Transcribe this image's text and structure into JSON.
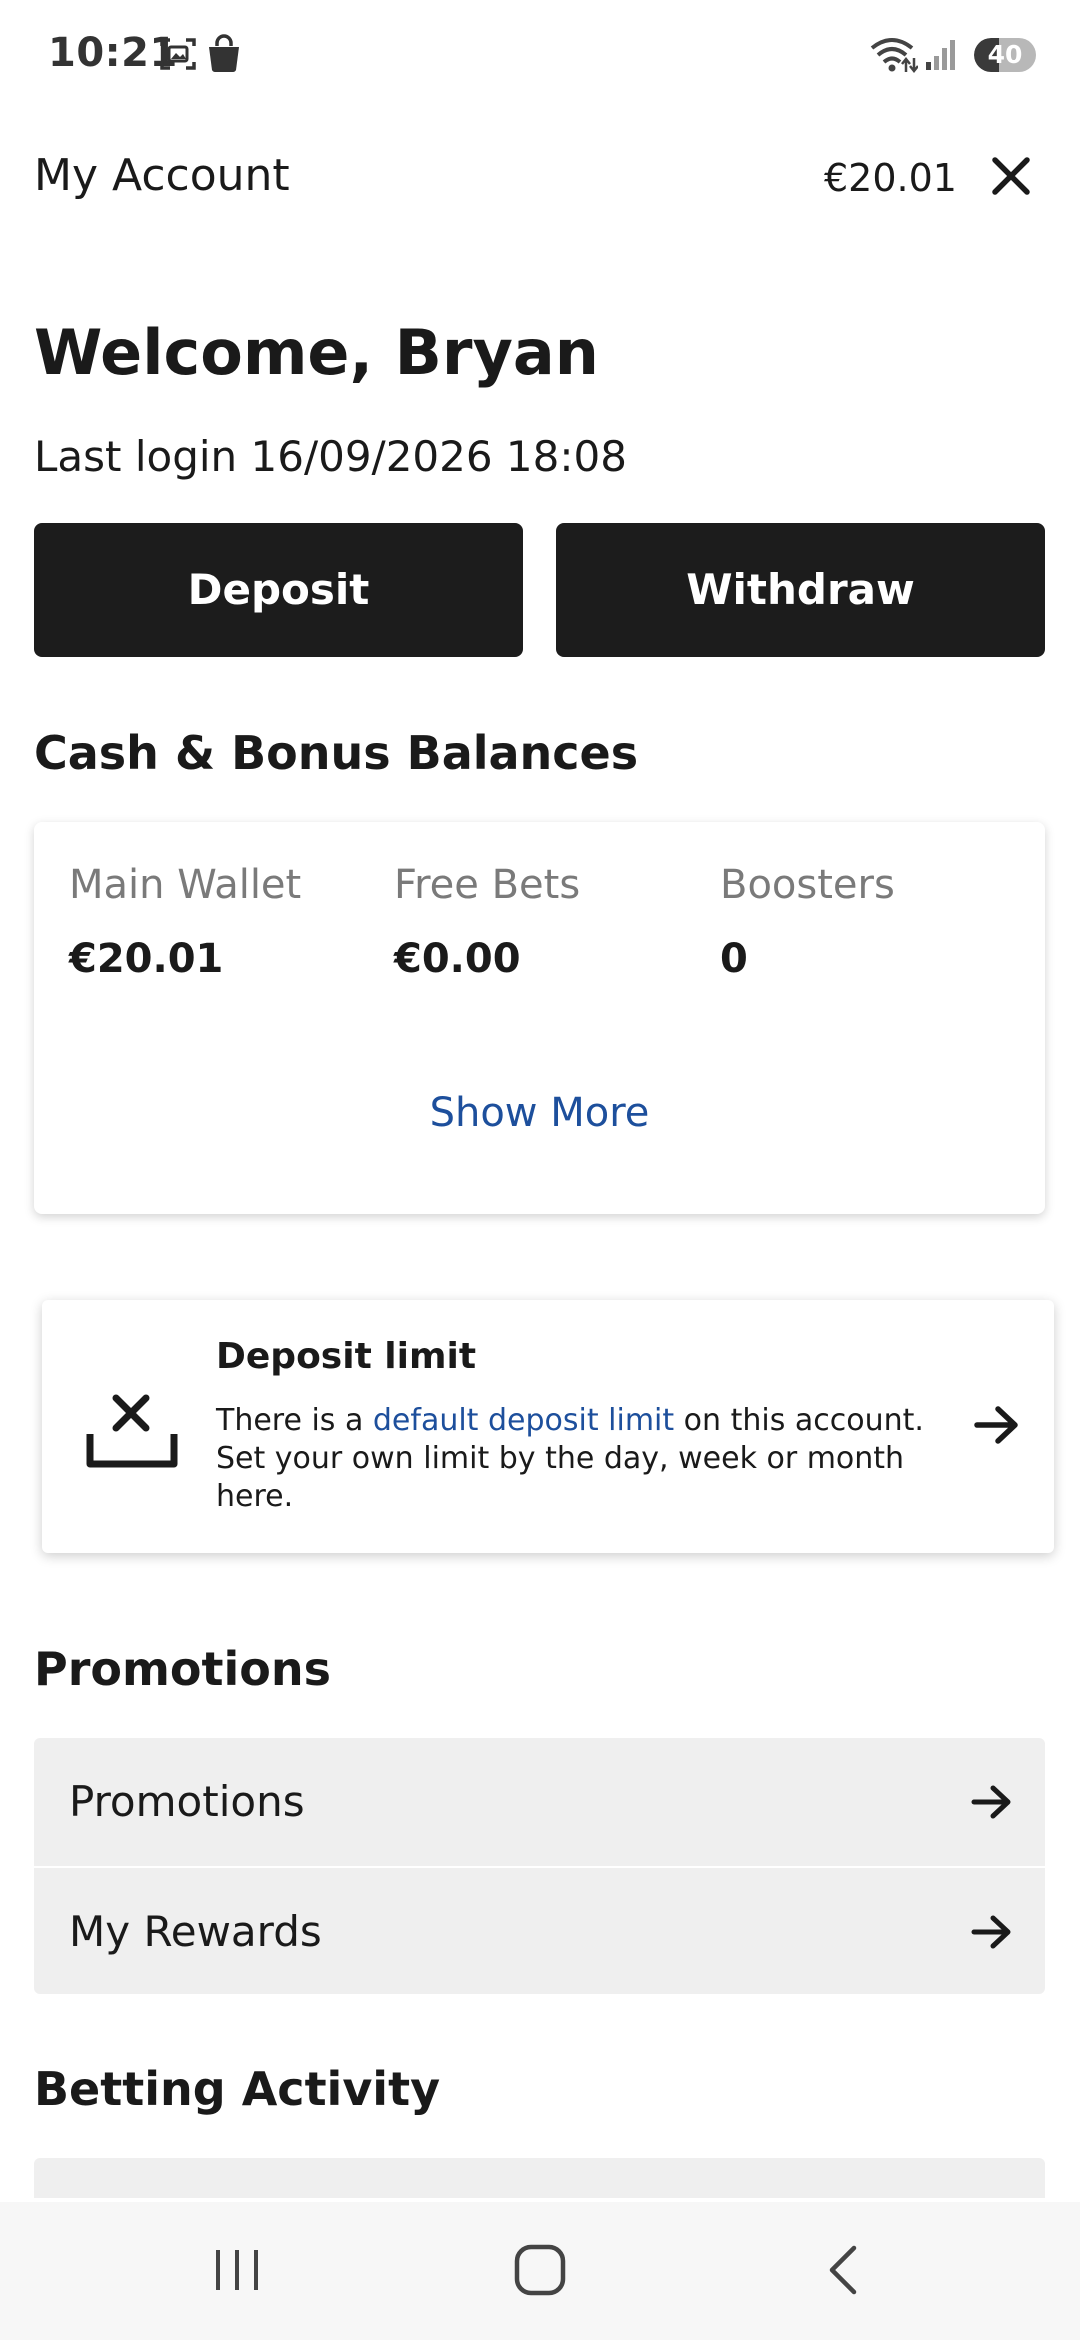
{
  "status_bar": {
    "time": "10:21",
    "battery_level": "40",
    "battery_fraction": 0.4,
    "icons": [
      "screenshot-icon",
      "bag-icon",
      "wifi-icon",
      "signal-icon",
      "battery-icon"
    ]
  },
  "header": {
    "title": "My Account",
    "balance": "€20.01",
    "close_icon": "close-icon"
  },
  "welcome": {
    "greeting": "Welcome, Bryan",
    "last_login": "Last login 16/09/2026 18:08"
  },
  "actions": {
    "deposit_label": "Deposit",
    "withdraw_label": "Withdraw"
  },
  "balances": {
    "heading": "Cash & Bonus Balances",
    "items": [
      {
        "label": "Main Wallet",
        "value": "€20.01"
      },
      {
        "label": "Free Bets",
        "value": "€0.00"
      },
      {
        "label": "Boosters",
        "value": "0"
      }
    ],
    "show_more": "Show More"
  },
  "deposit_limit": {
    "title": "Deposit limit",
    "text_before": "There is a ",
    "link": "default deposit limit",
    "text_after": " on this account. Set your own limit by the day, week or month here.",
    "icon": "limit-icon"
  },
  "promotions": {
    "heading": "Promotions",
    "items": [
      {
        "label": "Promotions"
      },
      {
        "label": "My Rewards"
      }
    ]
  },
  "betting": {
    "heading": "Betting Activity"
  },
  "colors": {
    "dark_button": "#1c1c1c",
    "link": "#1d4f9c",
    "list_bg": "#efefef"
  }
}
